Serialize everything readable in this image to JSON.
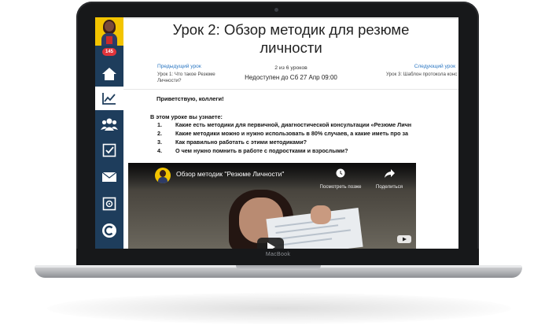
{
  "device": {
    "brand_label": "MacBook"
  },
  "sidebar": {
    "notification_count": "145",
    "items": [
      {
        "icon": "home-icon",
        "active": false
      },
      {
        "icon": "chart-icon",
        "active": true
      },
      {
        "icon": "users-icon",
        "active": false
      },
      {
        "icon": "checkbox-icon",
        "active": false
      },
      {
        "icon": "mail-icon",
        "active": false
      },
      {
        "icon": "safe-icon",
        "active": false
      },
      {
        "icon": "c-logo-icon",
        "active": false
      }
    ]
  },
  "lesson": {
    "title_line1": "Урок 2: Обзор методик для резюме",
    "title_line2": "личности",
    "prev": {
      "label": "Предыдущий урок",
      "title": "Урок 1: Что такое Резюме Личности?"
    },
    "counter": "2 из 6 уроков",
    "availability": "Недоступен до Сб 27 Апр 09:00",
    "next": {
      "label": "Следующий урок",
      "title": "Урок 3: Шаблон протокола консультации"
    },
    "greeting": "Приветствую, коллеги!",
    "learn_intro": "В этом уроке вы узнаете:",
    "items": [
      {
        "num": "1.",
        "text": "Какие есть методики для первичной, диагностической консультации «Резюме Личн"
      },
      {
        "num": "2.",
        "text": "Какие методики можно и нужно использовать в 80% случаев, а какие иметь про за"
      },
      {
        "num": "3.",
        "text": "Как правильно работать с этими методиками?"
      },
      {
        "num": "4.",
        "text": "О чем нужно помнить в работе с подростками и взрослыми?"
      }
    ]
  },
  "video": {
    "title": "Обзор методик \"Резюме Личности\"",
    "watch_later": "Посмотреть позже",
    "share": "Поделиться"
  },
  "colors": {
    "sidebar": "#1e3d5c",
    "link": "#2a76c2",
    "badge": "#e0343b",
    "avatar_bg": "#f3c400"
  }
}
